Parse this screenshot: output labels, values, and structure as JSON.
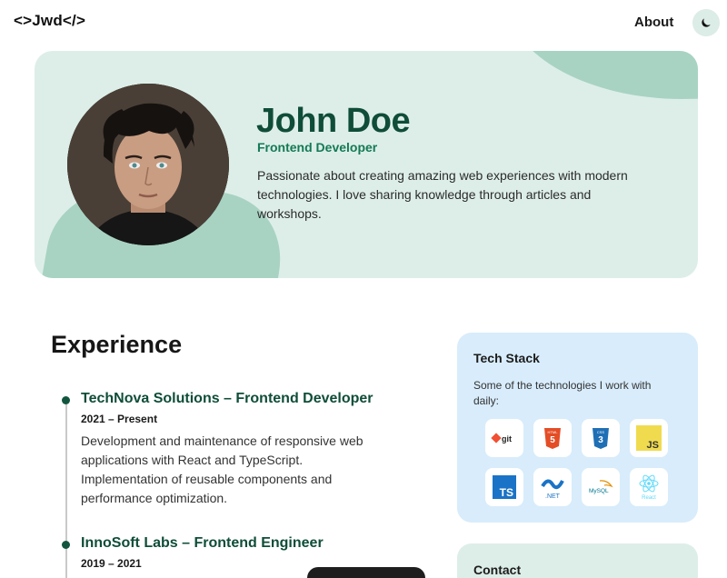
{
  "header": {
    "logo": "<>Jwd</>",
    "nav": {
      "about": "About"
    },
    "theme_toggle_icon": "moon-icon"
  },
  "hero": {
    "name": "John Doe",
    "role": "Frontend Developer",
    "bio": "Passionate about creating amazing web experiences with modern technologies. I love sharing knowledge through articles and workshops."
  },
  "experience": {
    "title": "Experience",
    "jobs": [
      {
        "title": "TechNova Solutions – Frontend Developer",
        "date": "2021 – Present",
        "description": "Development and maintenance of responsive web applications with React and TypeScript. Implementation of reusable components and performance optimization."
      },
      {
        "title": "InnoSoft Labs – Frontend Engineer",
        "date": "2019 – 2021"
      }
    ]
  },
  "tech_stack": {
    "title": "Tech Stack",
    "subtitle": "Some of the technologies I work with daily:",
    "items": [
      {
        "icon": "git-icon",
        "label": "git"
      },
      {
        "icon": "html5-icon",
        "label": "HTML"
      },
      {
        "icon": "css3-icon",
        "label": "CSS"
      },
      {
        "icon": "javascript-icon",
        "label": "JS"
      },
      {
        "icon": "typescript-icon",
        "label": "TS"
      },
      {
        "icon": "dotnet-icon",
        "label": ".NET"
      },
      {
        "icon": "mysql-icon",
        "label": "MySQL"
      },
      {
        "icon": "react-icon",
        "label": "React"
      }
    ]
  },
  "contact": {
    "title": "Contact"
  },
  "colors": {
    "accent_dark_green": "#0f4d38",
    "accent_green": "#137a55",
    "hero_bg": "#ddeee8",
    "hero_blob": "#a8d3c3",
    "tech_card_bg": "#d8ecfb"
  }
}
